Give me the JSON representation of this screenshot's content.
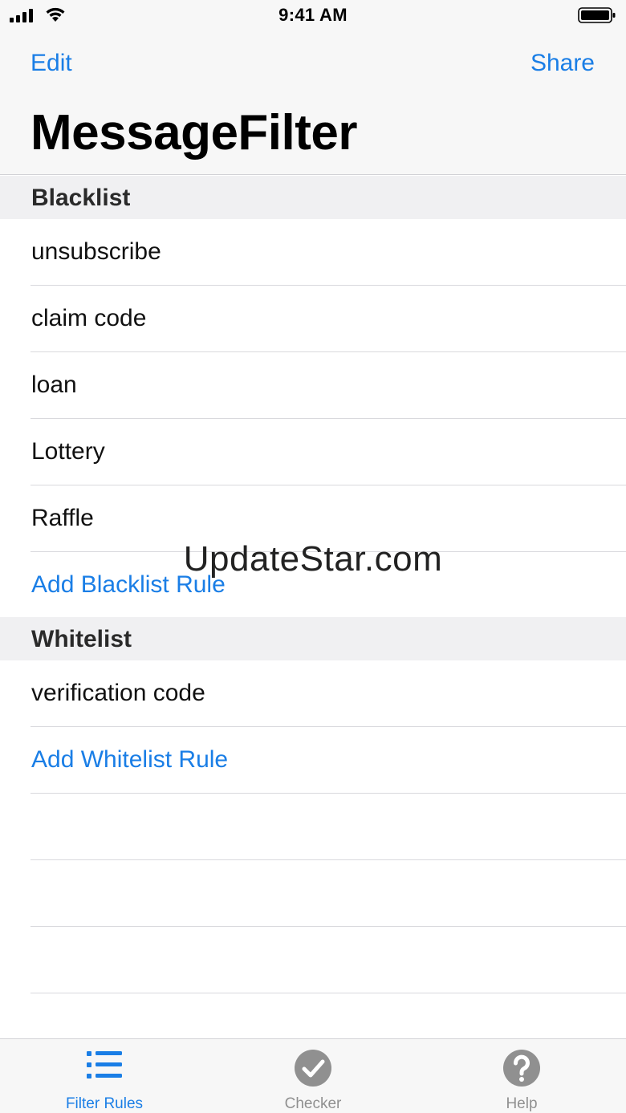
{
  "status_bar": {
    "time": "9:41 AM",
    "signal_icon": "cellular-signal-icon",
    "wifi_icon": "wifi-icon",
    "battery_icon": "battery-icon"
  },
  "nav": {
    "left_button": "Edit",
    "right_button": "Share",
    "title": "MessageFilter"
  },
  "blacklist": {
    "header": "Blacklist",
    "rules": [
      "unsubscribe",
      "claim code",
      "loan",
      "Lottery",
      "Raffle"
    ],
    "add_label": "Add Blacklist Rule"
  },
  "whitelist": {
    "header": "Whitelist",
    "rules": [
      "verification code"
    ],
    "add_label": "Add Whitelist Rule"
  },
  "watermark": "UpdateStar.com",
  "tabs": [
    {
      "label": "Filter Rules",
      "icon": "list-icon",
      "active": true
    },
    {
      "label": "Checker",
      "icon": "checkmark-circle-icon",
      "active": false
    },
    {
      "label": "Help",
      "icon": "question-circle-icon",
      "active": false
    }
  ],
  "colors": {
    "accent": "#1a7ee6",
    "inactive": "#909090",
    "bar_background": "#f7f7f7",
    "section_background": "#f0f0f2"
  }
}
